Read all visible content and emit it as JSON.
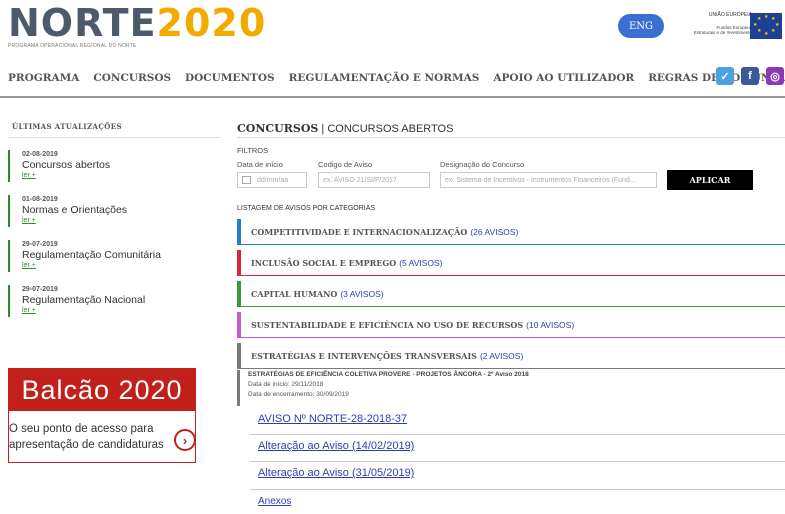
{
  "header": {
    "logo": {
      "word": "NORTE",
      "year": "2020",
      "subtitle": "PROGRAMA OPERACIONAL REGIONAL DO NORTE"
    },
    "lang_button": "ENG",
    "eu": {
      "line1": "UNIÃO EUROPEIA",
      "line2": "Fundos Europeus",
      "line3": "Estruturais e de Investimento"
    }
  },
  "nav": {
    "items": [
      "PROGRAMA",
      "CONCURSOS",
      "DOCUMENTOS",
      "REGULAMENTAÇÃO E NORMAS",
      "APOIO AO UTILIZADOR",
      "REGRAS DE COMUNICAÇÃO"
    ],
    "social": [
      {
        "name": "twitter-icon",
        "glyph": "🐦",
        "color": "#4aa3df"
      },
      {
        "name": "facebook-icon",
        "glyph": "f",
        "color": "#3b5998"
      },
      {
        "name": "instagram-icon",
        "glyph": "◎",
        "color": "#8a3ab9"
      }
    ]
  },
  "sidebar": {
    "title": "ÚLTIMAS ATUALIZAÇÕES",
    "updates": [
      {
        "date": "02-08-2019",
        "title": "Concursos abertos",
        "link": "ler +"
      },
      {
        "date": "01-08-2019",
        "title": "Normas e Orientações",
        "link": "ler +"
      },
      {
        "date": "29-07-2019",
        "title": "Regulamentação Comunitária",
        "link": "ler +"
      },
      {
        "date": "29-07-2019",
        "title": "Regulamentação Nacional",
        "link": "ler +"
      }
    ],
    "balcao": {
      "title": "Balcão 2020",
      "line1": "O seu ponto de acesso para",
      "line2": "apresentação de candidaturas",
      "arrow": "›"
    }
  },
  "content": {
    "title_bold": "CONCURSOS",
    "title_rest": " | CONCURSOS ABERTOS",
    "filters": {
      "label": "FILTROS",
      "date_label": "Data de início",
      "date_placeholder": "dd/mm/aa",
      "code_label": "Codigo de Aviso",
      "code_placeholder": "ex. AVISO 21/SI/F/2017",
      "name_label": "Designação do Concurso",
      "name_placeholder": "ex. Sistema de Incentivos - Instrumentos Financeiros (Fund...",
      "apply": "APLICAR"
    },
    "list_title": "LISTAGEM DE AVISOS POR CATEGORIAS",
    "categories": [
      {
        "name": "COMPETITIVIDADE E INTERNACIONALIZAÇÃO",
        "count": "(26 AVISOS)",
        "color": "#2a7cc7"
      },
      {
        "name": "INCLUSÃO SOCIAL E EMPREGO",
        "count": "(5 AVISOS)",
        "color": "#d9263f"
      },
      {
        "name": "CAPITAL HUMANO",
        "count": "(3 AVISOS)",
        "color": "#3a9a3a"
      },
      {
        "name": "SUSTENTABILIDADE E EFICIÊNCIA NO USO DE RECURSOS",
        "count": "(10 AVISOS)",
        "color": "#c45cc9"
      },
      {
        "name": "ESTRATÉGIAS E INTERVENÇÕES TRANSVERSAIS",
        "count": "(2 AVISOS)",
        "color": "#7a7a7a"
      }
    ],
    "sub": {
      "heading": "ESTRATÉGIAS DE EFICIÊNCIA COLETIVA PROVERE - PROJETOS ÂNCORA - 2º Aviso 2018",
      "start": "Data de início: 29/11/2018",
      "end": "Data de encerramento: 30/09/2019"
    },
    "links": [
      "AVISO Nº NORTE-28-2018-37",
      "Alteração ao Aviso (14/02/2019)",
      "Alteração ao Aviso (31/05/2019)",
      "Anexos"
    ]
  }
}
